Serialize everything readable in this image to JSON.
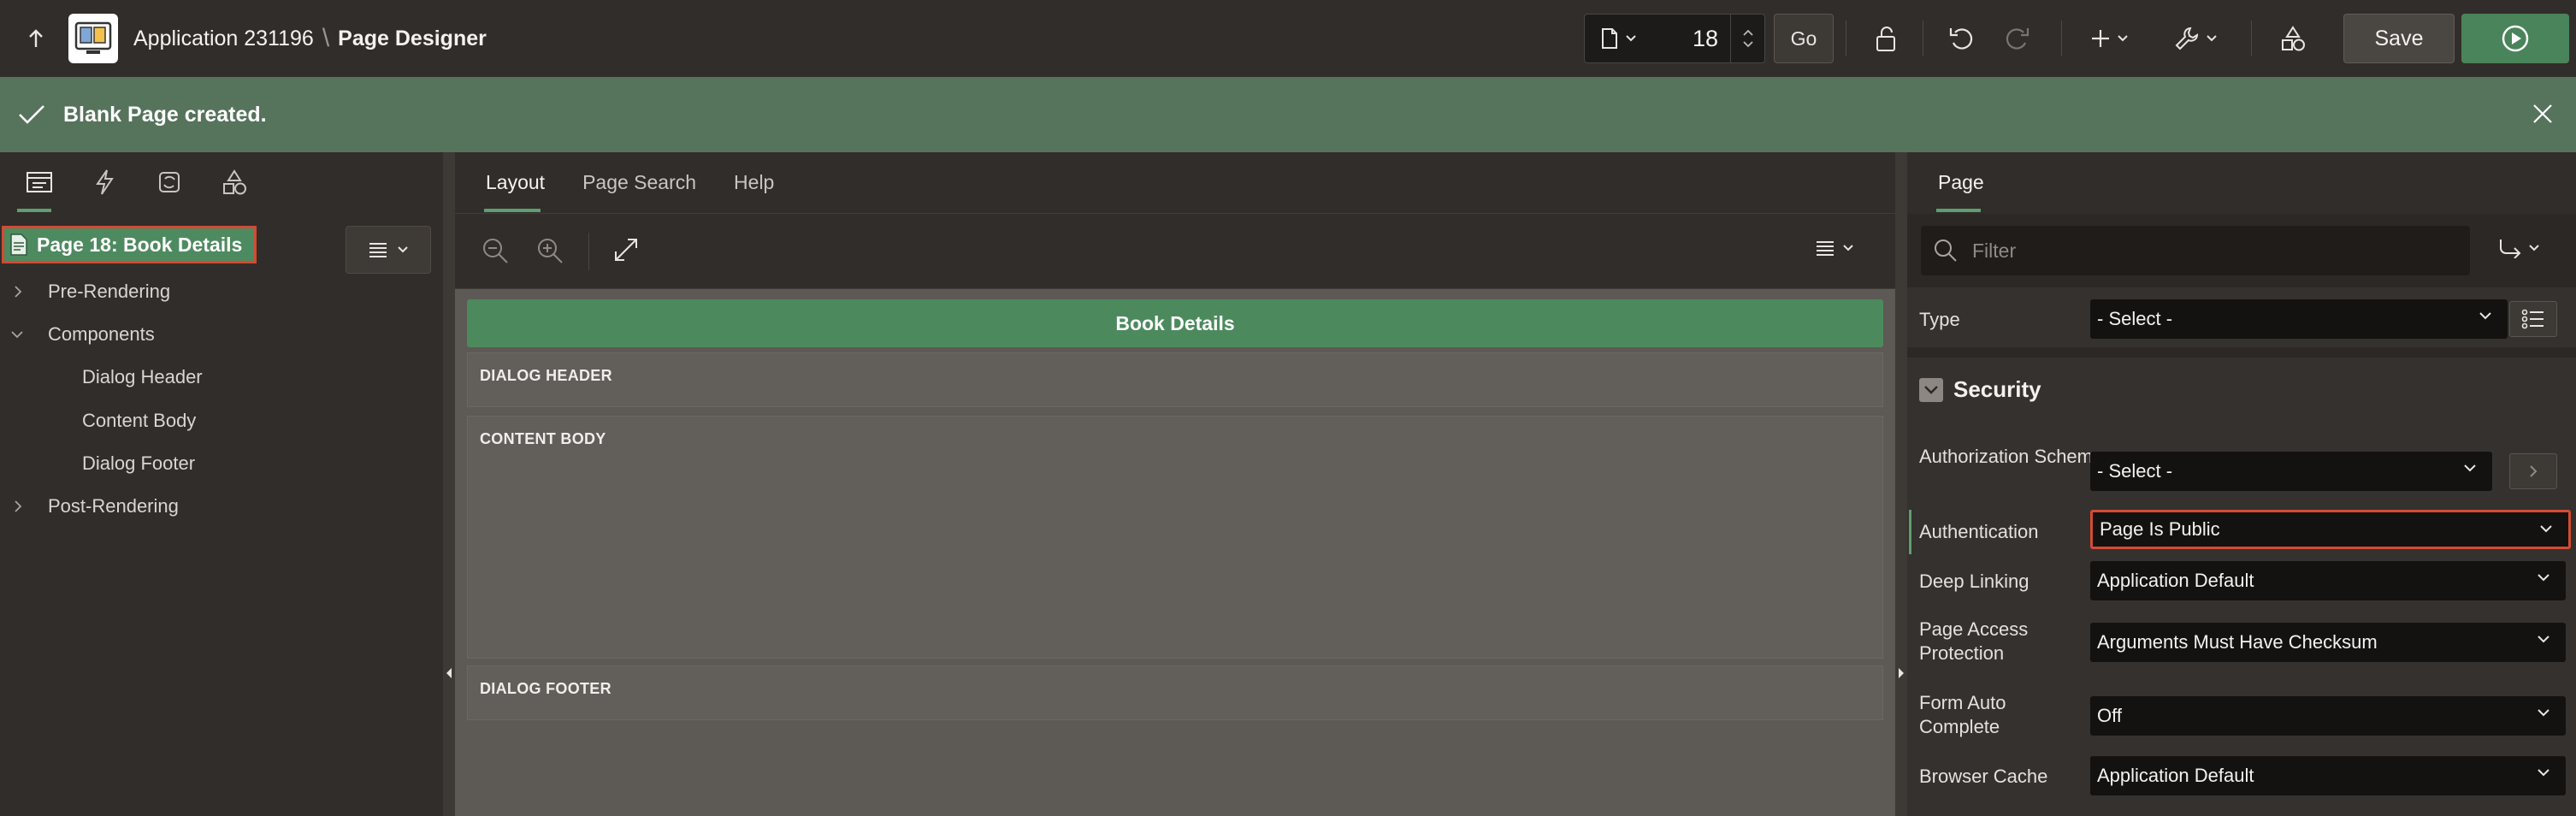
{
  "header": {
    "app_name": "Application 231196",
    "separator": "\\",
    "page_designer": "Page Designer",
    "page_number": "18",
    "go_label": "Go",
    "save_label": "Save"
  },
  "banner": {
    "message": "Blank Page created."
  },
  "left_pane": {
    "page_node_label": "Page 18: Book Details",
    "tree": [
      {
        "label": "Pre-Rendering",
        "expanded": false
      },
      {
        "label": "Components",
        "expanded": true
      },
      {
        "label": "Dialog Header"
      },
      {
        "label": "Content Body"
      },
      {
        "label": "Dialog Footer"
      },
      {
        "label": "Post-Rendering",
        "expanded": false
      }
    ]
  },
  "center_pane": {
    "tabs": [
      "Layout",
      "Page Search",
      "Help"
    ],
    "active_tab": "Layout",
    "region_title": "Book Details",
    "positions": [
      "DIALOG HEADER",
      "CONTENT BODY",
      "DIALOG FOOTER"
    ]
  },
  "right_pane": {
    "tab": "Page",
    "filter_placeholder": "Filter",
    "type_label": "Type",
    "type_value": "- Select -",
    "section_title": "Security",
    "properties": [
      {
        "label": "Authorization Scheme",
        "value": "- Select -"
      },
      {
        "label": "Authentication",
        "value": "Page Is Public"
      },
      {
        "label": "Deep Linking",
        "value": "Application Default"
      },
      {
        "label": "Page Access Protection",
        "value": "Arguments Must Have Checksum"
      },
      {
        "label": "Form Auto Complete",
        "value": "Off"
      },
      {
        "label": "Browser Cache",
        "value": "Application Default"
      }
    ]
  },
  "colors": {
    "accent_green": "#4c8a5d",
    "banner_green": "#56735c",
    "highlight_red": "#d34b33"
  }
}
